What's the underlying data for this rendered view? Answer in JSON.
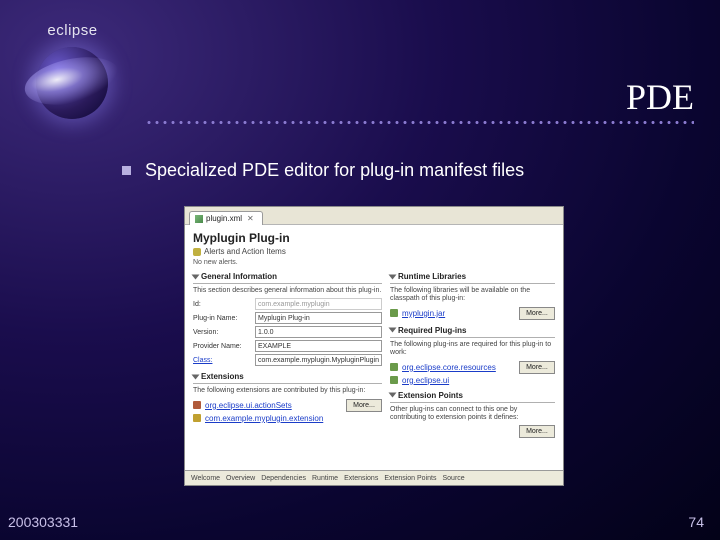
{
  "logo_text": "eclipse",
  "slide_title": "PDE",
  "bullet_text": "Specialized PDE editor for plug-in manifest files",
  "footer_id": "200303331",
  "footer_page": "74",
  "editor": {
    "tab_label": "plugin.xml",
    "doc_title": "Myplugin Plug-in",
    "alerts_label": "Alerts and Action Items",
    "no_alerts": "No new alerts.",
    "general": {
      "heading": "General Information",
      "desc": "This section describes general information about this plug-in.",
      "rows": {
        "id_label": "Id:",
        "id_value": "com.example.myplugin",
        "name_label": "Plug-in Name:",
        "name_value": "Myplugin Plug-in",
        "version_label": "Version:",
        "version_value": "1.0.0",
        "provider_label": "Provider Name:",
        "provider_value": "EXAMPLE",
        "class_label": "Class:",
        "class_value": "com.example.myplugin.MypluginPlugin"
      }
    },
    "runtime": {
      "heading": "Runtime Libraries",
      "desc": "The following libraries will be available on the classpath of this plug-in:",
      "lib": "myplugin.jar",
      "more": "More..."
    },
    "required": {
      "heading": "Required Plug-ins",
      "desc": "The following plug-ins are required for this plug-in to work:",
      "items": [
        "org.eclipse.core.resources",
        "org.eclipse.ui"
      ],
      "more": "More..."
    },
    "extensions": {
      "heading": "Extensions",
      "desc": "The following extensions are contributed by this plug-in:",
      "items": [
        "org.eclipse.ui.actionSets",
        "com.example.myplugin.extension"
      ],
      "more": "More..."
    },
    "ext_points": {
      "heading": "Extension Points",
      "desc": "Other plug-ins can connect to this one by contributing to extension points it defines:",
      "more": "More..."
    },
    "bottom_tabs": [
      "Welcome",
      "Overview",
      "Dependencies",
      "Runtime",
      "Extensions",
      "Extension Points",
      "Source"
    ]
  }
}
